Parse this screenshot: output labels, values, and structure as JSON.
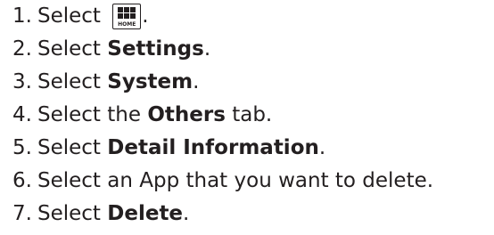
{
  "steps": [
    {
      "num": "1.",
      "pre": "Select ",
      "icon": "home-icon",
      "icon_label": "HOME",
      "post": "."
    },
    {
      "num": "2.",
      "pre": "Select ",
      "bold": "Settings",
      "post": "."
    },
    {
      "num": "3.",
      "pre": "Select ",
      "bold": "System",
      "post": "."
    },
    {
      "num": "4.",
      "pre": "Select the ",
      "bold": "Others",
      "post": " tab."
    },
    {
      "num": "5.",
      "pre": "Select ",
      "bold": "Detail Information",
      "post": "."
    },
    {
      "num": "6.",
      "pre": "Select an App that you want to delete."
    },
    {
      "num": "7.",
      "pre": "Select ",
      "bold": "Delete",
      "post": "."
    }
  ]
}
